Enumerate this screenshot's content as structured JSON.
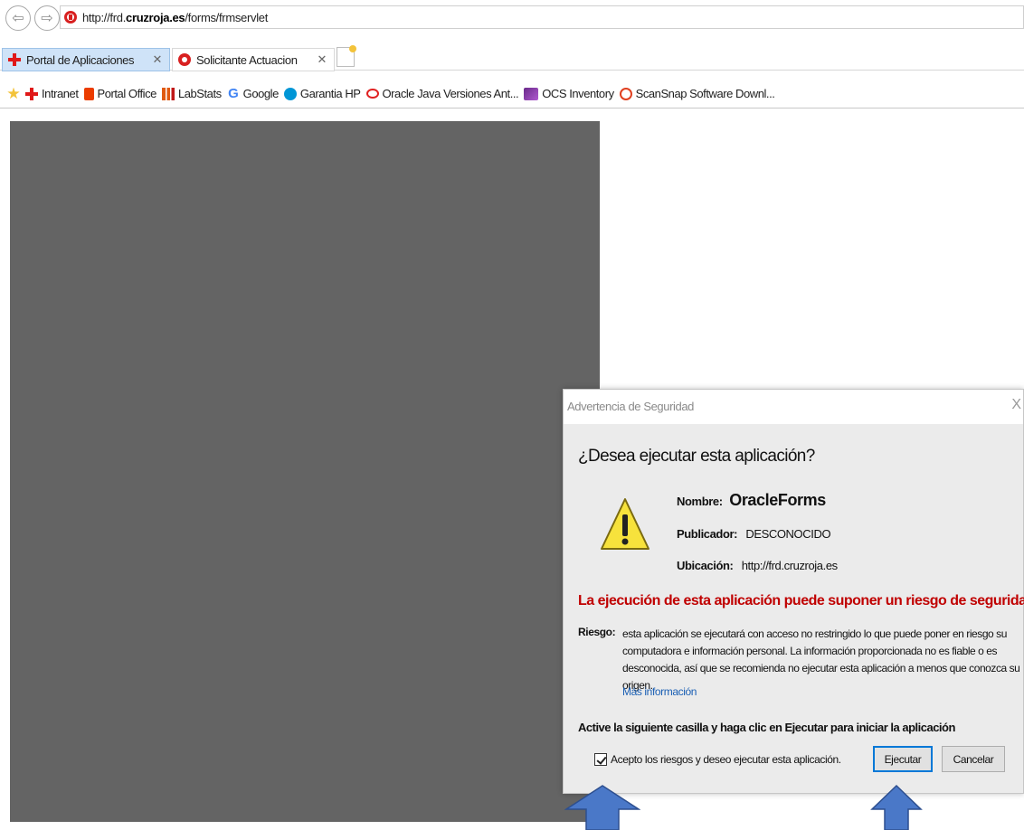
{
  "browser": {
    "url": {
      "prefix": "http://frd.",
      "domain": "cruzroja.es",
      "path": "/forms/frmservlet"
    },
    "tabs": [
      {
        "label": "Portal de Aplicaciones",
        "icon": "red-cross-icon",
        "active": true
      },
      {
        "label": "Solicitante Actuacion",
        "icon": "red-circle-icon",
        "active": false
      }
    ],
    "favorites": [
      {
        "label": "Intranet",
        "icon": "red-cross-icon"
      },
      {
        "label": "Portal Office",
        "icon": "office-icon"
      },
      {
        "label": "LabStats",
        "icon": "labstats-icon"
      },
      {
        "label": "Google",
        "icon": "google-icon"
      },
      {
        "label": "Garantia HP",
        "icon": "hp-icon"
      },
      {
        "label": "Oracle Java Versiones Ant...",
        "icon": "oracle-icon"
      },
      {
        "label": "OCS Inventory",
        "icon": "ocs-icon"
      },
      {
        "label": "ScanSnap Software Downl...",
        "icon": "scansnap-icon"
      }
    ]
  },
  "dialog": {
    "title": "Advertencia de Seguridad",
    "close_glyph": "X",
    "heading": "¿Desea ejecutar esta aplicación?",
    "name_label": "Nombre:",
    "name_value": "OracleForms",
    "publisher_label": "Publicador:",
    "publisher_value": "DESCONOCIDO",
    "location_label": "Ubicación:",
    "location_value": "http://frd.cruzroja.es",
    "risk_warning": "La ejecución de esta aplicación puede suponer un riesgo de seguridad",
    "risk_label": "Riesgo:",
    "risk_text": "esta aplicación se ejecutará con acceso no restringido lo que puede poner en riesgo su computadora e información personal. La información proporcionada no es fiable o es desconocida, así que se recomienda no ejecutar esta aplicación a menos que conozca su origen.",
    "more_info": "Más información",
    "instruction": "Active la siguiente casilla y haga clic en Ejecutar para iniciar la aplicación",
    "checkbox_label": "Acepto los riesgos y deseo ejecutar esta aplicación.",
    "checkbox_checked": true,
    "run_button": "Ejecutar",
    "cancel_button": "Cancelar"
  },
  "colors": {
    "applet_background": "#646464",
    "risk_red": "#c00000",
    "arrow_blue": "#4a78c8",
    "link_blue": "#1a5fb4"
  }
}
